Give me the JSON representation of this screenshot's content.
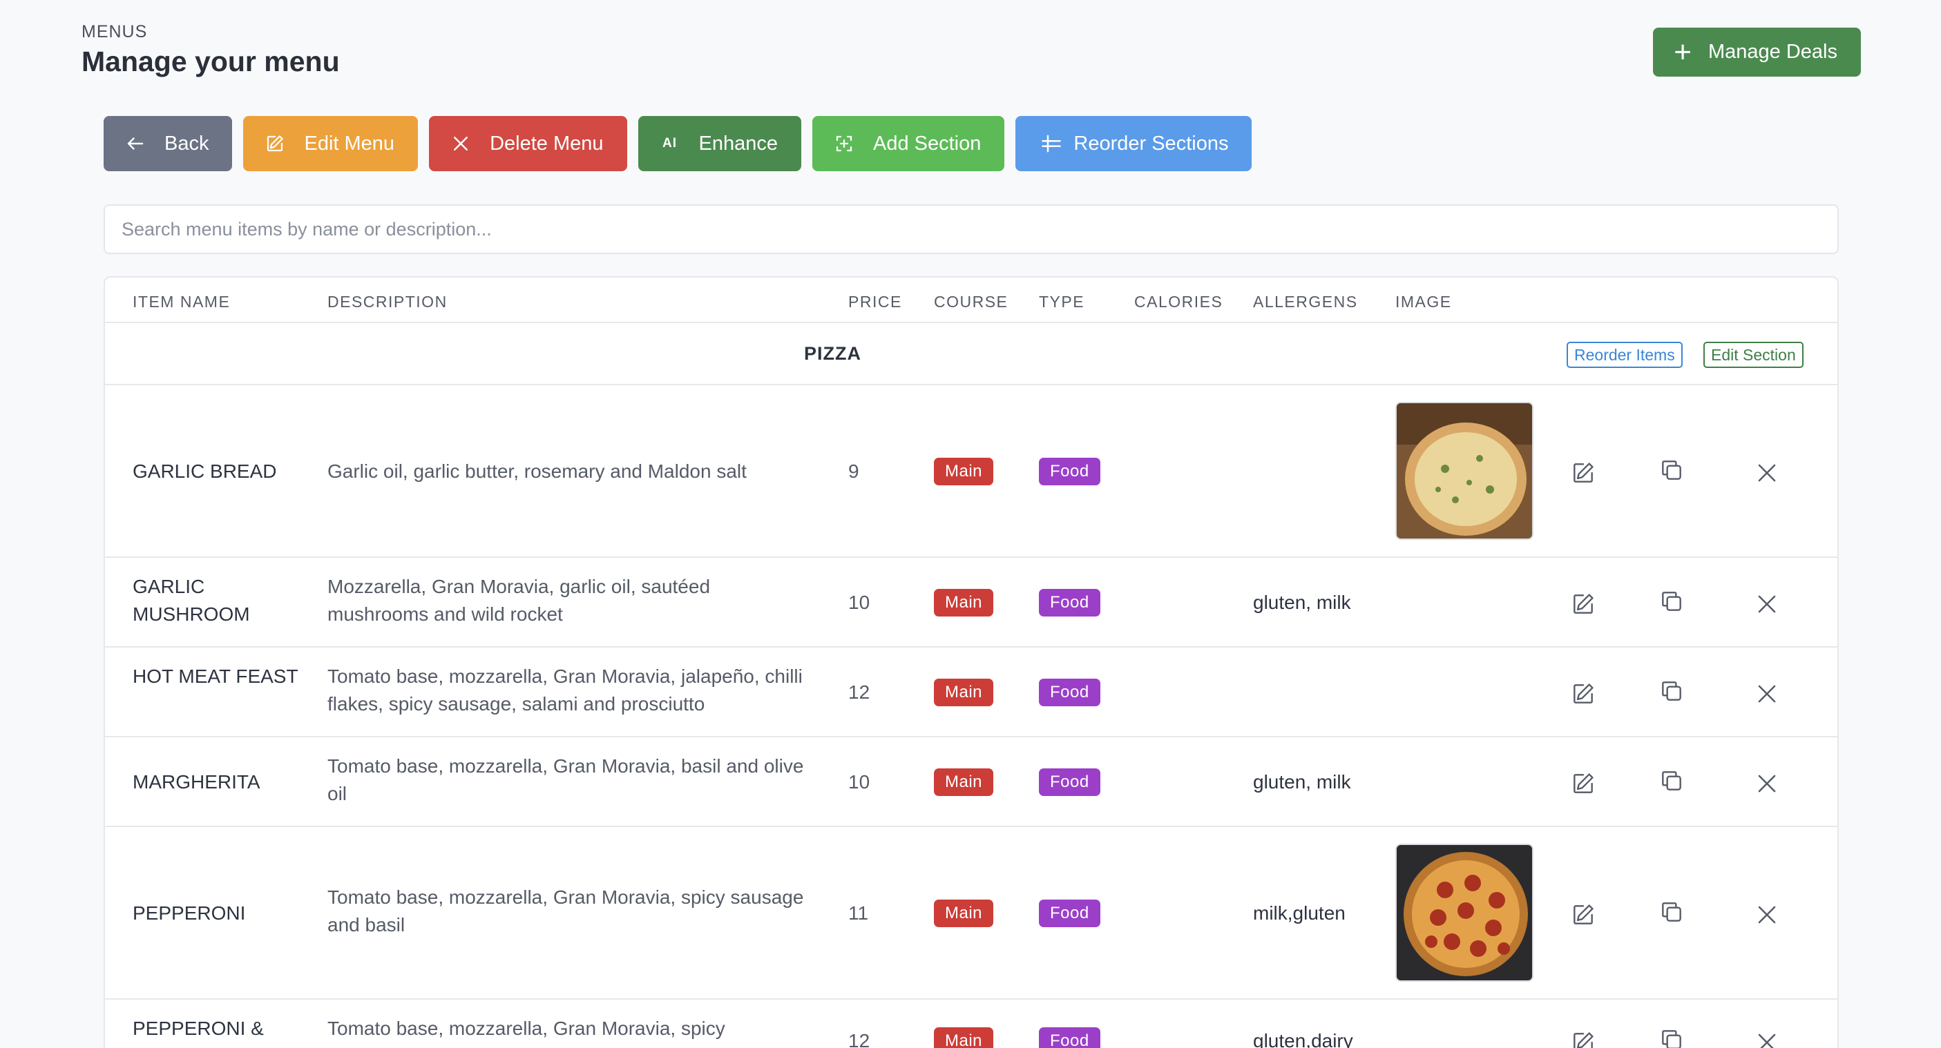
{
  "header": {
    "eyebrow": "MENUS",
    "title": "Manage your menu",
    "deals_button": "Manage Deals"
  },
  "toolbar": {
    "back": "Back",
    "edit_menu": "Edit Menu",
    "delete_menu": "Delete Menu",
    "enhance": "Enhance",
    "enhance_badge": "AI",
    "add_section": "Add Section",
    "reorder_sections": "Reorder Sections"
  },
  "search": {
    "placeholder": "Search menu items by name or description...",
    "value": ""
  },
  "table": {
    "columns": [
      "ITEM NAME",
      "DESCRIPTION",
      "PRICE",
      "COURSE",
      "TYPE",
      "CALORIES",
      "ALLERGENS",
      "IMAGE"
    ],
    "section": {
      "name": "PIZZA",
      "reorder_label": "Reorder Items",
      "edit_label": "Edit Section"
    },
    "rows": [
      {
        "name": "GARLIC BREAD",
        "description": "Garlic oil, garlic butter, rosemary and Maldon salt",
        "price": "9",
        "course": "Main",
        "type": "Food",
        "calories": "",
        "allergens": "",
        "image": "garlic-bread-pizza"
      },
      {
        "name": "GARLIC MUSHROOM",
        "description": "Mozzarella, Gran Moravia, garlic oil, sautéed mushrooms and wild rocket",
        "price": "10",
        "course": "Main",
        "type": "Food",
        "calories": "",
        "allergens": "gluten, milk",
        "image": ""
      },
      {
        "name": "HOT MEAT FEAST",
        "description": "Tomato base, mozzarella, Gran Moravia, jalapeño, chilli flakes, spicy sausage, salami and prosciutto",
        "price": "12",
        "course": "Main",
        "type": "Food",
        "calories": "",
        "allergens": "",
        "image": ""
      },
      {
        "name": "MARGHERITA",
        "description": "Tomato base, mozzarella, Gran Moravia, basil and olive oil",
        "price": "10",
        "course": "Main",
        "type": "Food",
        "calories": "",
        "allergens": "gluten, milk",
        "image": ""
      },
      {
        "name": "PEPPERONI",
        "description": "Tomato base, mozzarella, Gran Moravia, spicy sausage and basil",
        "price": "11",
        "course": "Main",
        "type": "Food",
        "calories": "",
        "allergens": "milk,gluten",
        "image": "pepperoni-pizza"
      },
      {
        "name": "PEPPERONI &",
        "description": "Tomato base, mozzarella, Gran Moravia, spicy",
        "price": "12",
        "course": "Main",
        "type": "Food",
        "calories": "",
        "allergens": "gluten,dairy",
        "image": ""
      }
    ]
  },
  "colors": {
    "back": "#6b7385",
    "edit": "#eda13a",
    "delete": "#d24a43",
    "enhance": "#4b8a4f",
    "add": "#5cbb57",
    "reorder": "#5a9bea",
    "course_badge": "#cc3d37",
    "type_badge": "#9b3fc9"
  }
}
